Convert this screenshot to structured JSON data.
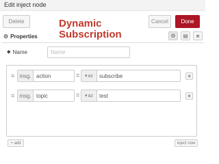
{
  "dialog": {
    "title": "Edit inject node"
  },
  "toolbar": {
    "delete_label": "Delete",
    "cancel_label": "Cancel",
    "done_label": "Done"
  },
  "overlay": {
    "line1": "Dynamic",
    "line2": "Subscription"
  },
  "tabs": {
    "properties_label": "Properties"
  },
  "name_field": {
    "label": "Name",
    "placeholder": "Name",
    "value": ""
  },
  "props": [
    {
      "type_tag": "msg.",
      "property": "action",
      "value_tag": "az",
      "value": "subscribe"
    },
    {
      "type_tag": "msg.",
      "property": "topic",
      "value_tag": "az",
      "value": "test"
    }
  ],
  "footer": {
    "add_label": "+ add",
    "inject_label": "inject now"
  },
  "colors": {
    "done_bg": "#ad1625",
    "overlay_text": "#c0392b"
  },
  "icons": [
    "gear-icon",
    "document-icon",
    "frame-icon",
    "tag-icon",
    "drag-handle-icon",
    "close-icon",
    "caret-down-icon",
    "az-icon"
  ]
}
